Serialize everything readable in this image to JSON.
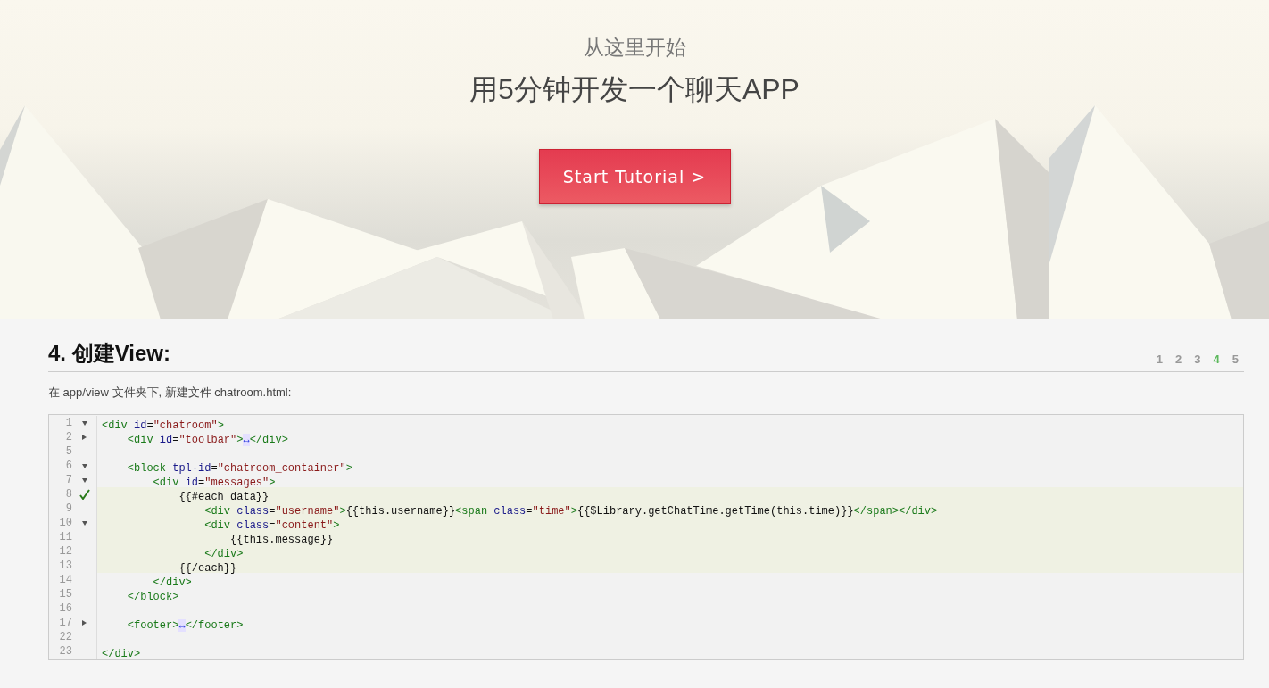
{
  "hero": {
    "subtitle": "从这里开始",
    "title": "用5分钟开发一个聊天APP",
    "button": "Start Tutorial >"
  },
  "section": {
    "heading": "4. 创建View:",
    "steps": [
      {
        "label": "1",
        "selected": false
      },
      {
        "label": "2",
        "selected": false
      },
      {
        "label": "3",
        "selected": false
      },
      {
        "label": "4",
        "selected": true
      },
      {
        "label": "5",
        "selected": false
      }
    ],
    "description": "在 app/view 文件夹下, 新建文件 chatroom.html:",
    "code": [
      {
        "number": "1",
        "kind": "expanded",
        "checked": false,
        "highlighted": false,
        "tokens": [
          {
            "kind": "tag",
            "text": "<div "
          },
          {
            "kind": "attr",
            "text": "id"
          },
          {
            "kind": "plain",
            "text": "="
          },
          {
            "kind": "string",
            "text": "\"chatroom\""
          },
          {
            "kind": "tag",
            "text": ">"
          }
        ]
      },
      {
        "number": "2",
        "kind": "collapsed",
        "checked": false,
        "highlighted": false,
        "tokens": [
          {
            "kind": "tag",
            "text": "    <div "
          },
          {
            "kind": "attr",
            "text": "id"
          },
          {
            "kind": "plain",
            "text": "="
          },
          {
            "kind": "string",
            "text": "\"toolbar\""
          },
          {
            "kind": "tag",
            "text": ">"
          },
          {
            "kind": "folded",
            "text": "↔"
          },
          {
            "kind": "tag",
            "text": "</div>"
          }
        ]
      },
      {
        "number": "5",
        "kind": "plain",
        "checked": false,
        "highlighted": false
      },
      {
        "number": "6",
        "kind": "expanded",
        "checked": false,
        "highlighted": false,
        "tokens": [
          {
            "kind": "tag",
            "text": "    <block "
          },
          {
            "kind": "attr",
            "text": "tpl-id"
          },
          {
            "kind": "plain",
            "text": "="
          },
          {
            "kind": "string",
            "text": "\"chatroom_container\""
          },
          {
            "kind": "tag",
            "text": ">"
          }
        ]
      },
      {
        "number": "7",
        "kind": "expanded",
        "checked": false,
        "highlighted": false,
        "tokens": [
          {
            "kind": "tag",
            "text": "        <div "
          },
          {
            "kind": "attr",
            "text": "id"
          },
          {
            "kind": "plain",
            "text": "="
          },
          {
            "kind": "string",
            "text": "\"messages\""
          },
          {
            "kind": "tag",
            "text": ">"
          }
        ]
      },
      {
        "number": "8",
        "kind": "plain",
        "checked": true,
        "highlighted": true,
        "tokens": [
          {
            "kind": "plain",
            "text": "            {{#each data}}"
          }
        ]
      },
      {
        "number": "9",
        "kind": "plain",
        "checked": false,
        "highlighted": true,
        "tokens": [
          {
            "kind": "tag",
            "text": "                <div "
          },
          {
            "kind": "attr",
            "text": "class"
          },
          {
            "kind": "plain",
            "text": "="
          },
          {
            "kind": "string",
            "text": "\"username\""
          },
          {
            "kind": "tag",
            "text": ">"
          },
          {
            "kind": "plain",
            "text": "{{this.username}}"
          },
          {
            "kind": "tag",
            "text": "<span "
          },
          {
            "kind": "attr",
            "text": "class"
          },
          {
            "kind": "plain",
            "text": "="
          },
          {
            "kind": "string",
            "text": "\"time\""
          },
          {
            "kind": "tag",
            "text": ">"
          },
          {
            "kind": "plain",
            "text": "{{$Library.getChatTime.getTime(this.time)}}"
          },
          {
            "kind": "tag",
            "text": "</span></div>"
          }
        ]
      },
      {
        "number": "10",
        "kind": "expanded",
        "checked": false,
        "highlighted": true,
        "tokens": [
          {
            "kind": "tag",
            "text": "                <div "
          },
          {
            "kind": "attr",
            "text": "class"
          },
          {
            "kind": "plain",
            "text": "="
          },
          {
            "kind": "string",
            "text": "\"content\""
          },
          {
            "kind": "tag",
            "text": ">"
          }
        ]
      },
      {
        "number": "11",
        "kind": "plain",
        "checked": false,
        "highlighted": true,
        "tokens": [
          {
            "kind": "plain",
            "text": "                    {{this.message}}"
          }
        ]
      },
      {
        "number": "12",
        "kind": "plain",
        "checked": false,
        "highlighted": true,
        "tokens": [
          {
            "kind": "tag",
            "text": "                </div>"
          }
        ]
      },
      {
        "number": "13",
        "kind": "plain",
        "checked": false,
        "highlighted": true,
        "tokens": [
          {
            "kind": "plain",
            "text": "            {{/each}}"
          }
        ]
      },
      {
        "number": "14",
        "kind": "plain",
        "checked": false,
        "highlighted": false,
        "tokens": [
          {
            "kind": "tag",
            "text": "        </div>"
          }
        ]
      },
      {
        "number": "15",
        "kind": "plain",
        "checked": false,
        "highlighted": false,
        "tokens": [
          {
            "kind": "tag",
            "text": "    </block>"
          }
        ]
      },
      {
        "number": "16",
        "kind": "plain",
        "checked": false,
        "highlighted": false
      },
      {
        "number": "17",
        "kind": "collapsed",
        "checked": false,
        "highlighted": false,
        "tokens": [
          {
            "kind": "tag",
            "text": "    <footer>"
          },
          {
            "kind": "folded",
            "text": "↔"
          },
          {
            "kind": "tag",
            "text": "</footer>"
          }
        ]
      },
      {
        "number": "22",
        "kind": "plain",
        "checked": false,
        "highlighted": false
      },
      {
        "number": "23",
        "kind": "plain",
        "checked": false,
        "highlighted": false,
        "tokens": [
          {
            "kind": "tag",
            "text": "</div>"
          }
        ]
      }
    ]
  }
}
